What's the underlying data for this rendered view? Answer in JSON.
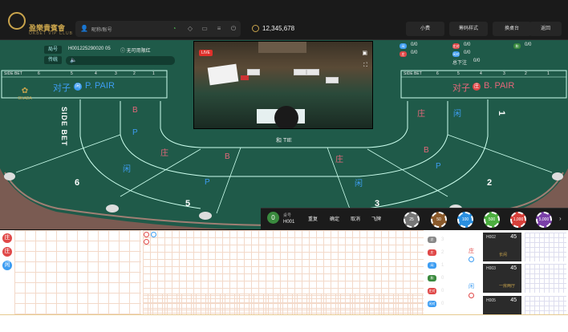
{
  "brand": {
    "name": "盈樂貴賓會",
    "sub": "OKBET VIP CLUB",
    "table_logo": "OKADA"
  },
  "user": {
    "name": "昵称/账号",
    "balance": "12,345,678"
  },
  "top_buttons": [
    "小费",
    "筹码样式",
    "换桌台",
    "返回"
  ],
  "round": {
    "label": "局号",
    "value": "H001225290020 05",
    "limit": "无可用限红",
    "mode": "传统"
  },
  "video": {
    "live": "LIVE"
  },
  "stats": {
    "banker_pair": "0/0",
    "player_pair": "0/0",
    "label3": "0/0",
    "label4": "0/0",
    "tie": "0/0",
    "total_label": "总下注",
    "total": "0/0"
  },
  "table": {
    "side_bet": "SIDE BET",
    "side_bet_vertical": "SIDE BET",
    "left_numbers": [
      "6",
      "5",
      "4",
      "3",
      "2",
      "1"
    ],
    "right_numbers": [
      "6",
      "5",
      "4",
      "3",
      "2",
      "1"
    ],
    "player_pair_label": "对子",
    "player_pair_badge": "闲",
    "player_pair_en": "P. PAIR",
    "banker_pair_label": "对子",
    "banker_pair_badge": "庄",
    "banker_pair_en": "B. PAIR",
    "tie_label": "和 TIE",
    "zone": {
      "banker": "庄",
      "player": "闲",
      "b": "B",
      "p": "P"
    },
    "seat_numbers": [
      "6",
      "5",
      "3",
      "2",
      "1"
    ]
  },
  "chipbar": {
    "countdown": "0",
    "table_label": "桌号",
    "table_value": "H001",
    "actions": [
      "重复",
      "确定",
      "取消",
      "飞牌"
    ],
    "chips": [
      "25",
      "50",
      "100",
      "500",
      "1,000",
      "5,000"
    ]
  },
  "road": {
    "beads": [
      "庄",
      "庄",
      "闲"
    ],
    "legend": [
      {
        "badge": "庄",
        "count": "3"
      },
      {
        "badge": "庄",
        "count": "2"
      },
      {
        "badge": "闲",
        "count": "1"
      },
      {
        "badge": "和",
        "count": "0"
      },
      {
        "badge": "庄对",
        "count": "0"
      },
      {
        "badge": "闲对",
        "count": "0"
      }
    ],
    "predict": [
      "庄",
      "闲"
    ]
  },
  "table_list": [
    {
      "id": "H002",
      "count": "45",
      "status": "长闲"
    },
    {
      "id": "H003",
      "count": "45",
      "status": "一房两厅"
    },
    {
      "id": "H005",
      "count": "45",
      "status": ""
    }
  ],
  "colors": {
    "felt": "#1f5a49",
    "banker": "#e04848",
    "player": "#3d9df2",
    "tie": "#3a8a3e",
    "gold": "#c9a44c"
  }
}
